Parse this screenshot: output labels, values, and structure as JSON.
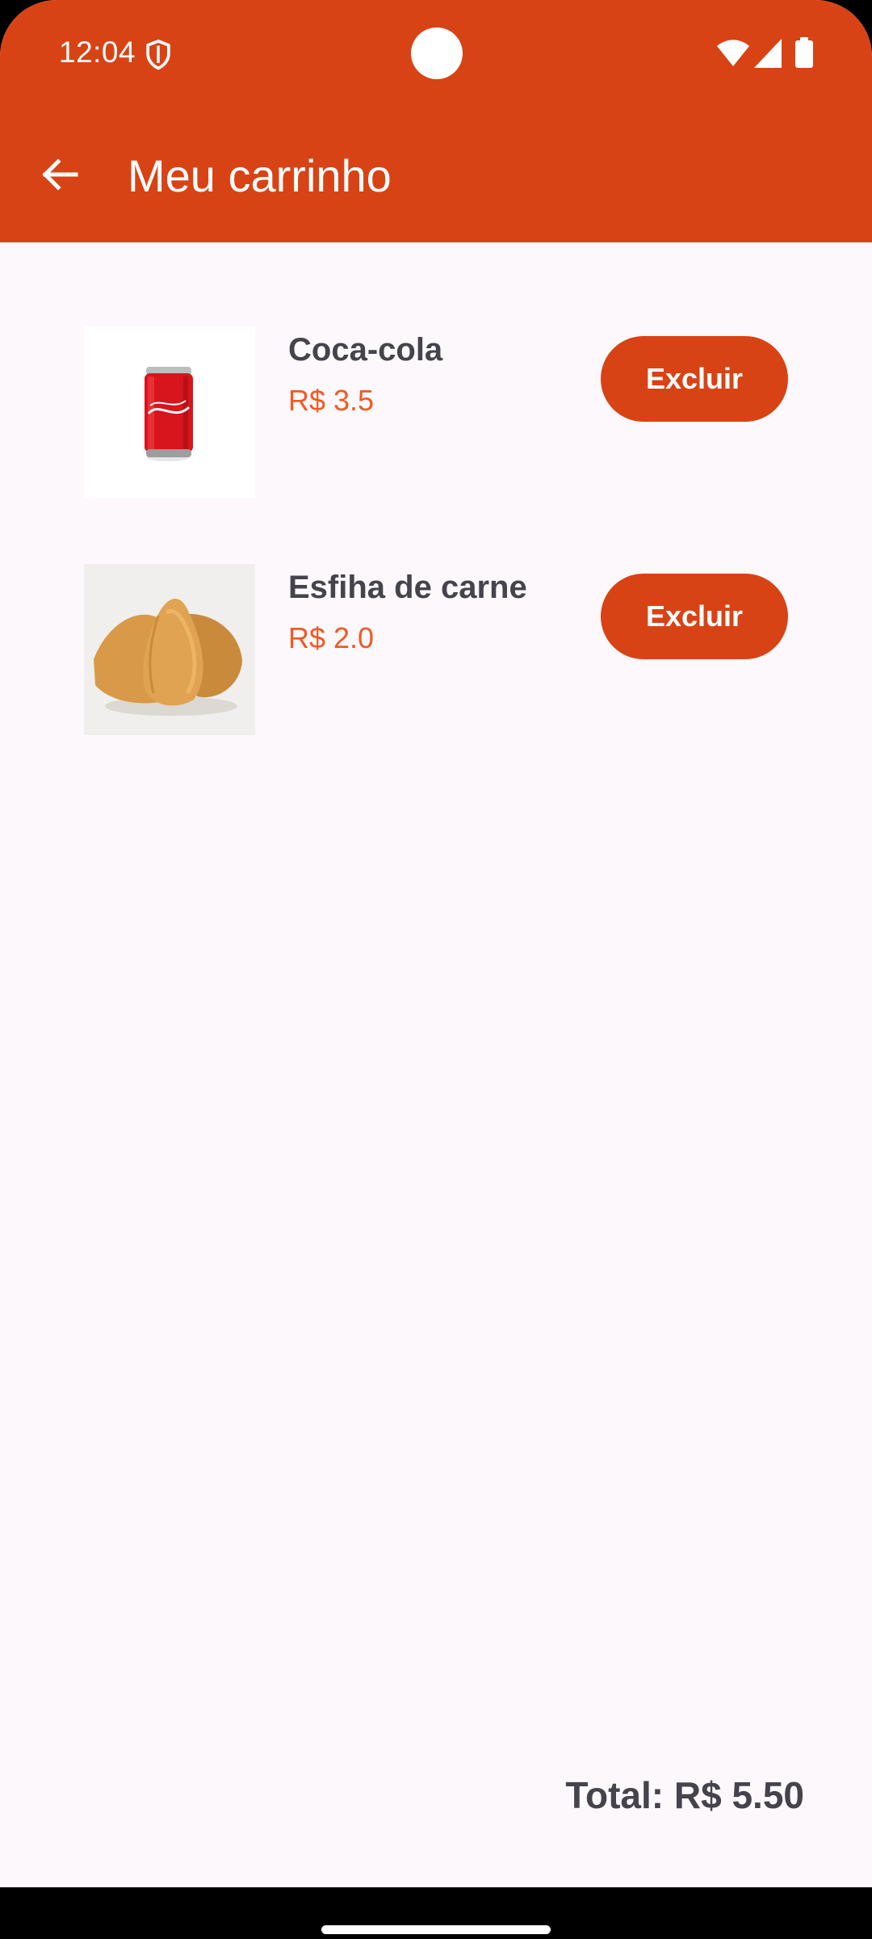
{
  "status_bar": {
    "time": "12:04",
    "icons": [
      "shield-icon",
      "wifi-icon",
      "signal-icon",
      "battery-icon"
    ]
  },
  "app_bar": {
    "title": "Meu carrinho",
    "back_icon": "arrow-left-icon"
  },
  "cart": {
    "items": [
      {
        "name": "Coca-cola",
        "price": "R$ 3.5",
        "button_label": "Excluir",
        "image": "coca-cola-can"
      },
      {
        "name": "Esfiha de carne",
        "price": "R$ 2.0",
        "button_label": "Excluir",
        "image": "esfiha"
      }
    ],
    "total": "Total: R$ 5.50"
  },
  "colors": {
    "primary": "#d84315",
    "price": "#f05a22",
    "text": "#45434b",
    "background": "#fdf8fc"
  }
}
